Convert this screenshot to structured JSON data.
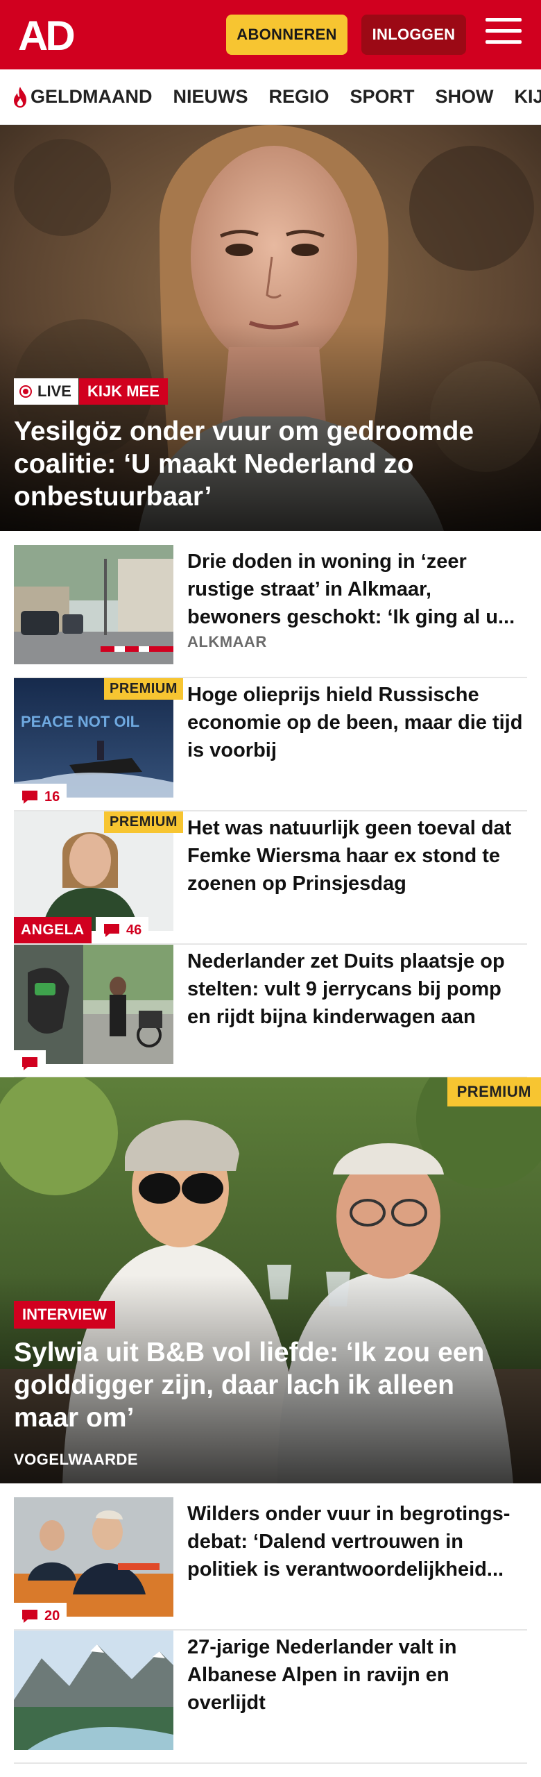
{
  "header": {
    "logo_text": "AD",
    "subscribe_label": "ABONNEREN",
    "login_label": "INLOGGEN",
    "brand_color": "#d1001f"
  },
  "nav": {
    "items": [
      {
        "label": "GELDMAAND",
        "icon": "flame-icon"
      },
      {
        "label": "NIEUWS"
      },
      {
        "label": "REGIO"
      },
      {
        "label": "SPORT"
      },
      {
        "label": "SHOW"
      },
      {
        "label": "KIJK"
      }
    ]
  },
  "hero": {
    "live_label": "LIVE",
    "watch_label": "KIJK MEE",
    "title": "Yesilgöz onder vuur om gedroomde coalitie: ‘U maakt Nederland zo onbestuurbaar’"
  },
  "articles": [
    {
      "title": "Drie doden in woning in ‘zeer rustige straat’ in Alkmaar, bewoners geschokt: ‘Ik ging al u...",
      "location": "ALKMAAR"
    },
    {
      "title": "Hoge olieprijs hield Russische economie op de been, maar die tijd is voorbij",
      "premium": "PREMIUM",
      "comments": "16",
      "image_text": "PEACE NOT OIL"
    },
    {
      "title": "Het was natuurlijk geen toeval dat Femke Wiersma haar ex stond te zoenen op Prinsjesdag",
      "premium": "PREMIUM",
      "label": "ANGELA",
      "comments": "46"
    },
    {
      "title": "Nederlander zet Duits plaatsje op stelten: vult 9 jerrycans bij pomp en rijdt bijna kinderwagen aan",
      "comments": ""
    }
  ],
  "feature": {
    "premium": "PREMIUM",
    "tag": "INTERVIEW",
    "title": "Sylwia uit B&B vol liefde: ‘Ik zou een golddigger zijn, daar lach ik alleen maar om’",
    "location": "VOGELWAARDE"
  },
  "articles_bottom": [
    {
      "title": "Wilders onder vuur in begrotings-debat: ‘Dalend vertrouwen in politiek is verantwoordelijkheid...",
      "comments": "20"
    },
    {
      "title": "27-jarige Nederlander valt in Albanese Alpen in ravijn en overlijdt"
    }
  ]
}
